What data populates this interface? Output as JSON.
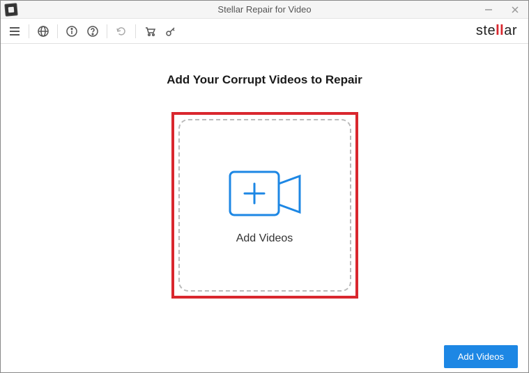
{
  "window": {
    "title": "Stellar Repair for Video"
  },
  "brand": {
    "prefix": "ste",
    "accent": "ll",
    "suffix": "ar"
  },
  "main": {
    "heading": "Add Your Corrupt Videos to Repair",
    "dropzone_label": "Add Videos"
  },
  "footer": {
    "add_button": "Add Videos"
  }
}
